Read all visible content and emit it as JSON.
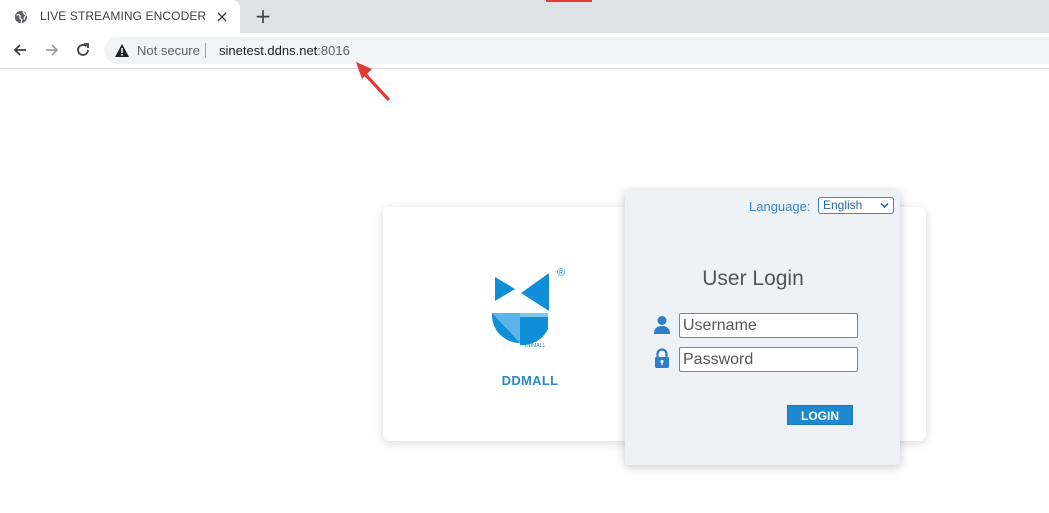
{
  "browser": {
    "tab": {
      "title": "LIVE STREAMING ENCODER",
      "close_glyph": "×",
      "favicon": "globe-icon"
    },
    "new_tab_glyph": "+",
    "omnibox": {
      "security_label": "Not secure",
      "url_host": "sinetest.ddns.net",
      "url_port": ":8016",
      "warning_icon": "warning-triangle-icon"
    }
  },
  "brand": {
    "name": "DDMALL",
    "registered_mark": "®",
    "logo_small_text": "DDMALL"
  },
  "login": {
    "language_label": "Language:",
    "language_value": "English",
    "title": "User Login",
    "username_placeholder": "Username",
    "password_placeholder": "Password",
    "submit_label": "LOGIN"
  },
  "colors": {
    "accent": "#1e88d1",
    "brand_blue": "#2a8bc8",
    "annotation_red": "#e53935"
  }
}
